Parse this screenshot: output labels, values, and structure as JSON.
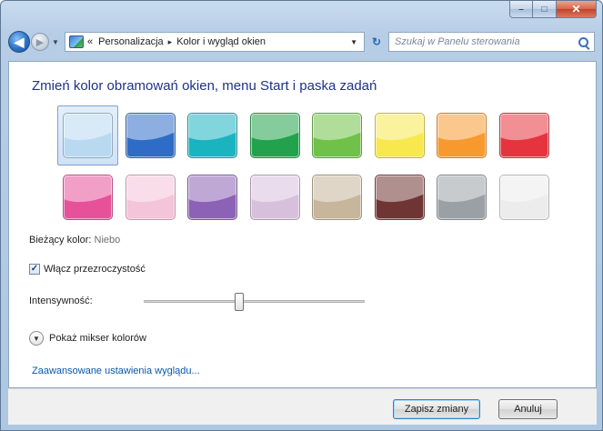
{
  "window": {
    "caption_buttons": {
      "minimize": "–",
      "maximize": "□",
      "close": "✕"
    }
  },
  "navigation": {
    "back_glyph": "◀",
    "forward_glyph": "▶",
    "history_glyph": "▼",
    "breadcrumb_prefix": "«",
    "breadcrumb": [
      "Personalizacja",
      "Kolor i wygląd okien"
    ],
    "breadcrumb_separator": "▸",
    "address_dropdown_glyph": "▼",
    "refresh_glyph": "↻",
    "search_placeholder": "Szukaj w Panelu sterowania"
  },
  "main": {
    "title": "Zmień kolor obramowań okien, menu Start i paska zadań",
    "swatches": [
      {
        "color": "#b9d9f1",
        "selected": true
      },
      {
        "color": "#2e6cc8",
        "selected": false
      },
      {
        "color": "#1ab4c1",
        "selected": false
      },
      {
        "color": "#22a24c",
        "selected": false
      },
      {
        "color": "#6fc148",
        "selected": false
      },
      {
        "color": "#f7e84e",
        "selected": false
      },
      {
        "color": "#f8992e",
        "selected": false
      },
      {
        "color": "#e5343e",
        "selected": false
      },
      {
        "color": "#e7519a",
        "selected": false
      },
      {
        "color": "#f4c4d9",
        "selected": false
      },
      {
        "color": "#8b62b5",
        "selected": false
      },
      {
        "color": "#d7c0dc",
        "selected": false
      },
      {
        "color": "#c7b59c",
        "selected": false
      },
      {
        "color": "#6e3533",
        "selected": false
      },
      {
        "color": "#9aa0a6",
        "selected": false
      },
      {
        "color": "#ececec",
        "selected": false
      }
    ],
    "current_color_label": "Bieżący kolor:",
    "current_color_value": "Niebo",
    "transparency_label": "Włącz przezroczystość",
    "transparency_checked": true,
    "transparency_check_glyph": "✓",
    "intensity_label": "Intensywność:",
    "intensity_value": 0.43,
    "mixer_glyph": "▼",
    "mixer_label": "Pokaż mikser kolorów",
    "advanced_link": "Zaawansowane ustawienia wyglądu..."
  },
  "footer": {
    "save_label": "Zapisz zmiany",
    "cancel_label": "Anuluj"
  }
}
